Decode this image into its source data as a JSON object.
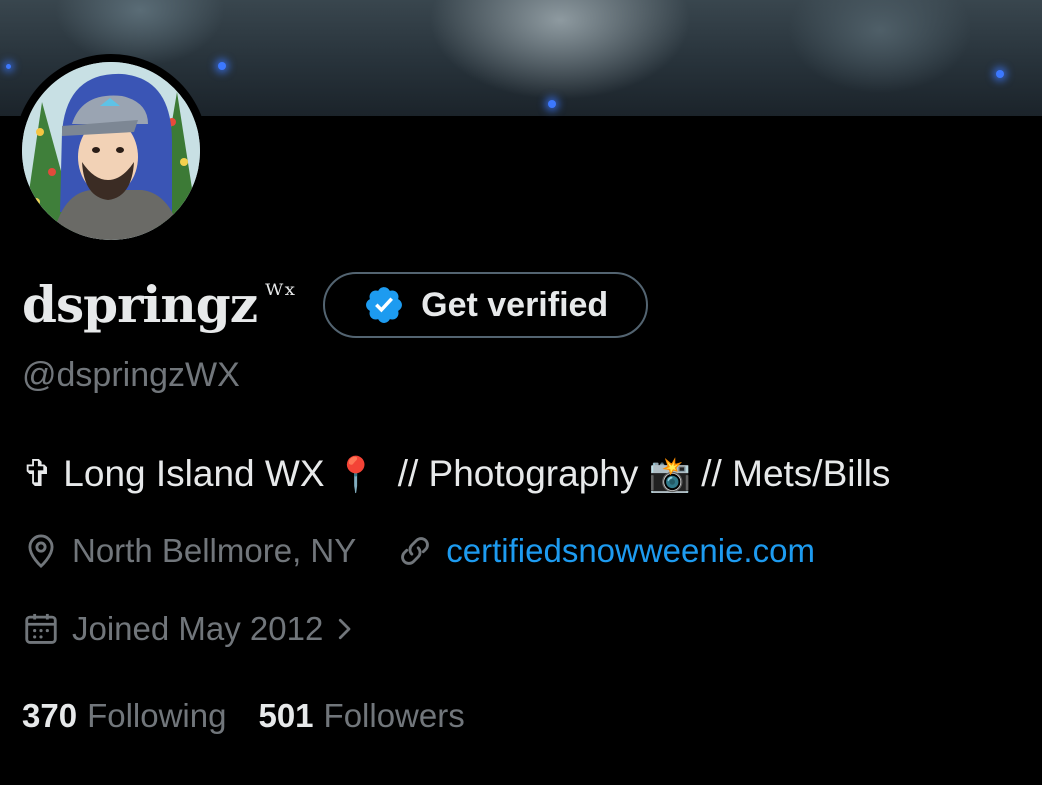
{
  "profile": {
    "display_name": "dspringz",
    "display_name_sup": "ᵂˣ",
    "handle": "@dspringzWX",
    "verify_label": "Get verified",
    "bio_parts": {
      "cross": "✞",
      "location_text": "Long Island WX",
      "pin_emoji": "📍",
      "sep1": "// Photography",
      "camera_emoji": "📸",
      "sep2": "// Mets/Bills"
    },
    "location": "North Bellmore, NY",
    "website": "certifiedsnowweenie.com",
    "joined": "Joined May 2012",
    "following_count": "370",
    "following_label": "Following",
    "followers_count": "501",
    "followers_label": "Followers"
  },
  "icons": {
    "verified": "verified-badge-icon",
    "location": "location-pin-icon",
    "link": "link-icon",
    "calendar": "calendar-icon",
    "chevron": "chevron-right-icon"
  },
  "colors": {
    "background": "#000000",
    "primary_text": "#e7e9ea",
    "secondary_text": "#71767b",
    "link": "#1d9bf0",
    "verified_blue": "#1d9bf0",
    "button_border": "#536471"
  }
}
